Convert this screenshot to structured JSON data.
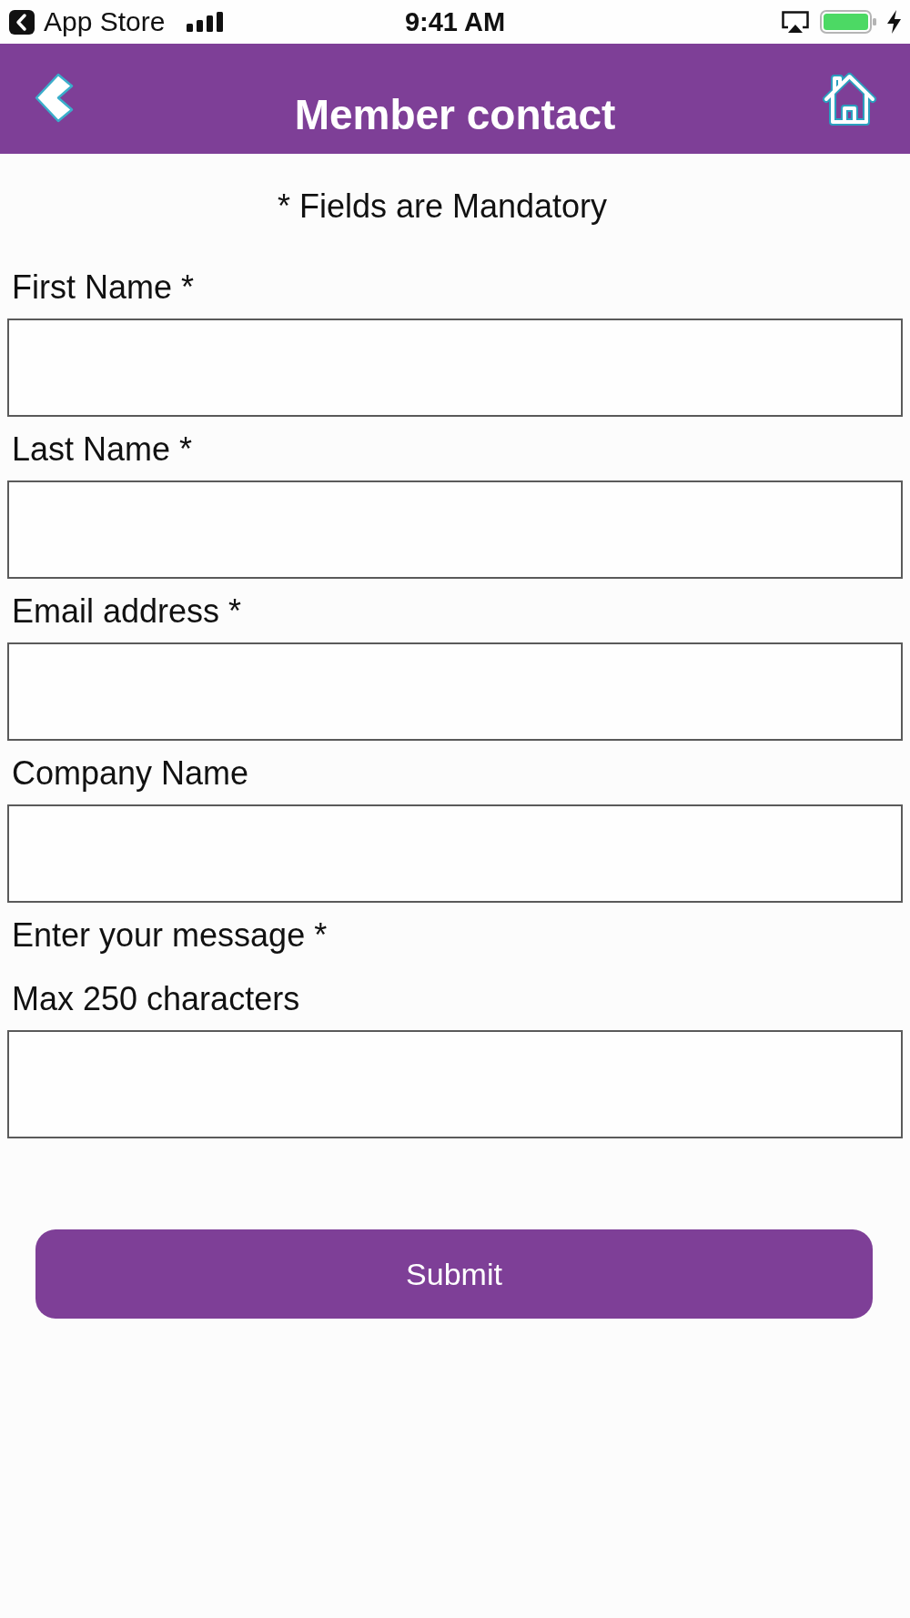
{
  "status_bar": {
    "back_label": "App Store",
    "time": "9:41 AM"
  },
  "header": {
    "title": "Member contact"
  },
  "form": {
    "note": "* Fields are Mandatory",
    "fields": [
      {
        "label": "First Name *",
        "kind": "text"
      },
      {
        "label": "Last Name *",
        "kind": "text"
      },
      {
        "label": "Email address *",
        "kind": "text"
      },
      {
        "label": "Company Name",
        "kind": "text"
      },
      {
        "label": "Enter your message *",
        "hint": "Max 250 characters",
        "kind": "multiline"
      }
    ],
    "submit": "Submit"
  }
}
